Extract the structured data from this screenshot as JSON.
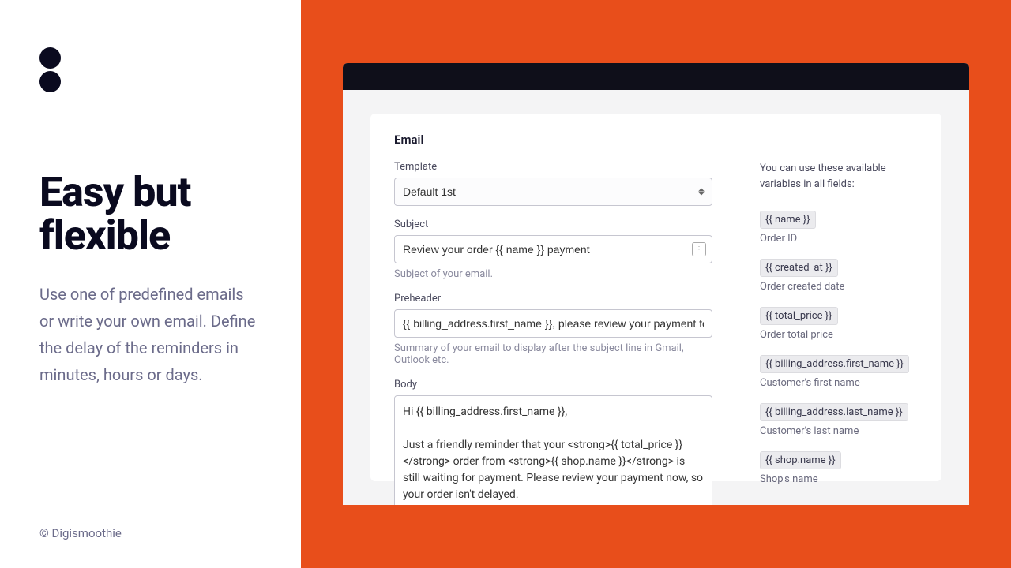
{
  "left": {
    "heading": "Easy but flexible",
    "description": "Use one of predefined emails or write your own email. Define the delay of the reminders in minutes, hours or days.",
    "copyright": "© Digismoothie"
  },
  "form": {
    "title": "Email",
    "template": {
      "label": "Template",
      "value": "Default 1st"
    },
    "subject": {
      "label": "Subject",
      "value": "Review your order {{ name }} payment",
      "helper": "Subject of your email."
    },
    "preheader": {
      "label": "Preheader",
      "value": "{{ billing_address.first_name }}, please review your payment for your {{ total_price }} order",
      "helper": "Summary of your email to display after the subject line in Gmail, Outlook etc."
    },
    "body": {
      "label": "Body",
      "value": "Hi {{ billing_address.first_name }},\n\nJust a friendly reminder that your <strong>{{ total_price }}</strong> order from <strong>{{ shop.name }}</strong> is still waiting for payment. Please review your payment now, so your order isn't delayed."
    }
  },
  "vars": {
    "intro": "You can use these available variables in all fields:",
    "items": [
      {
        "tag": "{{ name }}",
        "desc": "Order ID"
      },
      {
        "tag": "{{ created_at }}",
        "desc": "Order created date"
      },
      {
        "tag": "{{ total_price }}",
        "desc": "Order total price"
      },
      {
        "tag": "{{ billing_address.first_name }}",
        "desc": "Customer's first name"
      },
      {
        "tag": "{{ billing_address.last_name }}",
        "desc": "Customer's last name"
      },
      {
        "tag": "{{ shop.name }}",
        "desc": "Shop's name"
      }
    ]
  }
}
